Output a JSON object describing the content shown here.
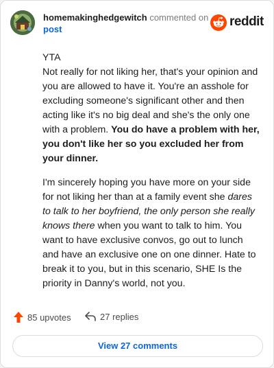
{
  "comment": {
    "username": "homemakinghedgewitch",
    "action_text": "commented on",
    "post_link": "post",
    "paragraph1": {
      "lines": [
        "YTA",
        "Not really for not liking her, that's your opinion and you are allowed to have it. You're an asshole for excluding someone's significant other and then acting like it's no big deal and she's the only one with a problem. "
      ],
      "bold": "You do have a problem with her, you don't like her so you excluded her from your dinner."
    },
    "paragraph2": {
      "before_italic": "I'm sincerely hoping you have more on your side for not liking her than at a family event she ",
      "italic": "dares to talk to her boyfriend, the only person she really knows there",
      "after_italic": " when you want to talk to him. You want to have exclusive convos, go out to lunch and have an exclusive one on one dinner. Hate to break it to you, but in this scenario, SHE Is the priority in Danny's world, not you."
    }
  },
  "brand": {
    "wordmark": "reddit",
    "accent": "#ff4500"
  },
  "footer": {
    "upvotes": "85 upvotes",
    "replies": "27 replies",
    "view_comments": "View 27 comments"
  },
  "icons": {
    "avatar": "avatar",
    "logo": "reddit-logo-icon",
    "upvote": "upvote-arrow-icon",
    "reply": "reply-arrow-icon"
  }
}
